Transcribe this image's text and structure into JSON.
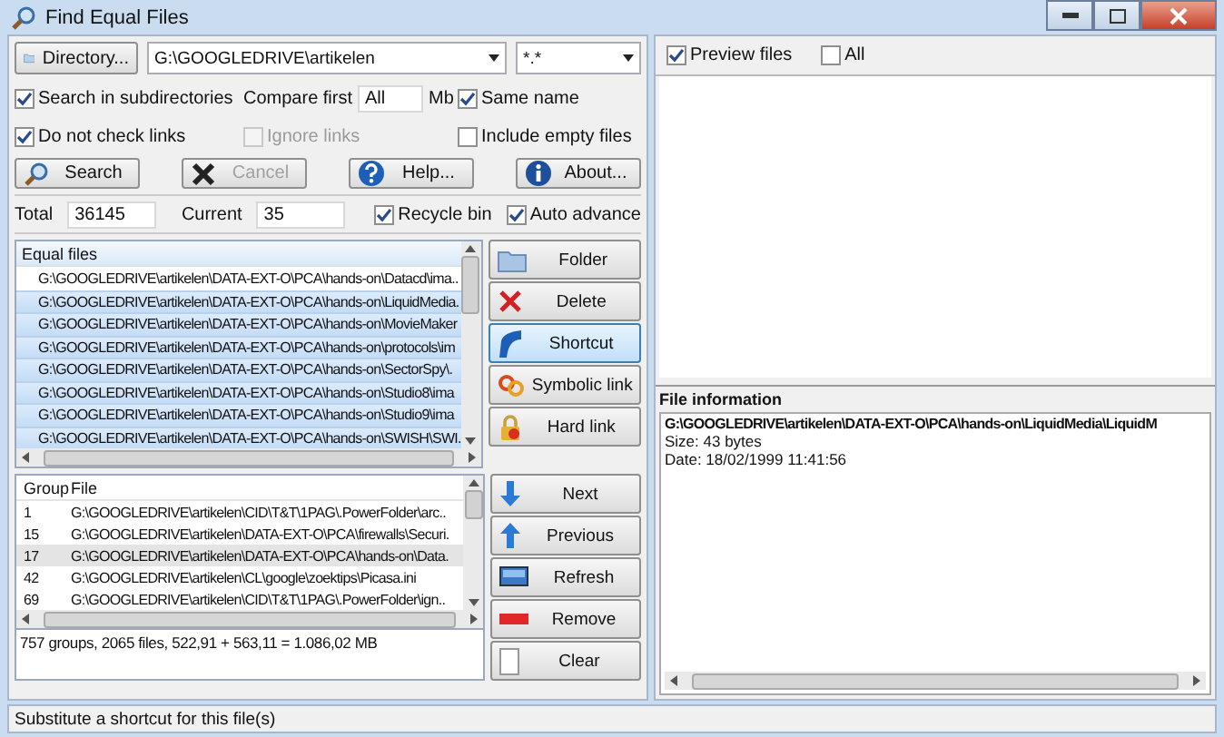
{
  "window": {
    "title": "Find Equal Files"
  },
  "search": {
    "directory_button": "Directory...",
    "path": "G:\\GOOGLEDRIVE\\artikelen",
    "mask": "*.*",
    "options": [
      {
        "label": "Search in subdirectories",
        "checked": true,
        "disabled": false
      },
      {
        "label": "Same name",
        "checked": true,
        "disabled": false
      },
      {
        "label": "Do not check links",
        "checked": true,
        "disabled": false
      },
      {
        "label": "Ignore links",
        "checked": false,
        "disabled": true
      },
      {
        "label": "Include empty files",
        "checked": false,
        "disabled": false
      }
    ],
    "compare_first": {
      "label": "Compare first",
      "value": "All",
      "unit": "Mb"
    }
  },
  "actions": [
    {
      "label": "Search",
      "disabled": false
    },
    {
      "label": "Cancel",
      "disabled": true
    },
    {
      "label": "Help...",
      "disabled": false
    },
    {
      "label": "About...",
      "disabled": false
    }
  ],
  "counters": {
    "total_label": "Total",
    "total": "36145",
    "current_label": "Current",
    "current": "35",
    "options": [
      {
        "label": "Recycle bin",
        "checked": true
      },
      {
        "label": "Auto advance",
        "checked": true
      }
    ]
  },
  "equal_files": {
    "header": "Equal files",
    "rows": [
      {
        "path": "G:\\GOOGLEDRIVE\\artikelen\\DATA-EXT-O\\PCA\\hands-on\\Datacd\\ima..",
        "selected": false
      },
      {
        "path": "G:\\GOOGLEDRIVE\\artikelen\\DATA-EXT-O\\PCA\\hands-on\\LiquidMedia.",
        "selected": true
      },
      {
        "path": "G:\\GOOGLEDRIVE\\artikelen\\DATA-EXT-O\\PCA\\hands-on\\MovieMaker",
        "selected": true
      },
      {
        "path": "G:\\GOOGLEDRIVE\\artikelen\\DATA-EXT-O\\PCA\\hands-on\\protocols\\im",
        "selected": true
      },
      {
        "path": "G:\\GOOGLEDRIVE\\artikelen\\DATA-EXT-O\\PCA\\hands-on\\SectorSpy\\.",
        "selected": true
      },
      {
        "path": "G:\\GOOGLEDRIVE\\artikelen\\DATA-EXT-O\\PCA\\hands-on\\Studio8\\ima",
        "selected": true
      },
      {
        "path": "G:\\GOOGLEDRIVE\\artikelen\\DATA-EXT-O\\PCA\\hands-on\\Studio9\\ima",
        "selected": true
      },
      {
        "path": "G:\\GOOGLEDRIVE\\artikelen\\DATA-EXT-O\\PCA\\hands-on\\SWISH\\SWI.",
        "selected": true
      }
    ]
  },
  "file_buttons": [
    {
      "label": "Folder",
      "selected": false
    },
    {
      "label": "Delete",
      "selected": false
    },
    {
      "label": "Shortcut",
      "selected": true
    },
    {
      "label": "Symbolic link",
      "selected": false
    },
    {
      "label": "Hard link",
      "selected": false
    }
  ],
  "groups": {
    "columns": [
      "Group",
      "File"
    ],
    "rows": [
      {
        "group": "1",
        "file": "G:\\GOOGLEDRIVE\\artikelen\\CID\\T&T\\1PAG\\.PowerFolder\\arc..",
        "selected": false
      },
      {
        "group": "15",
        "file": "G:\\GOOGLEDRIVE\\artikelen\\DATA-EXT-O\\PCA\\firewalls\\Securi.",
        "selected": false
      },
      {
        "group": "17",
        "file": "G:\\GOOGLEDRIVE\\artikelen\\DATA-EXT-O\\PCA\\hands-on\\Data.",
        "selected": true
      },
      {
        "group": "42",
        "file": "G:\\GOOGLEDRIVE\\artikelen\\CL\\google\\zoektips\\Picasa.ini",
        "selected": false
      },
      {
        "group": "69",
        "file": "G:\\GOOGLEDRIVE\\artikelen\\CID\\T&T\\1PAG\\.PowerFolder\\ign..",
        "selected": false
      }
    ]
  },
  "nav_buttons": [
    {
      "label": "Next"
    },
    {
      "label": "Previous"
    },
    {
      "label": "Refresh"
    },
    {
      "label": "Remove"
    },
    {
      "label": "Clear"
    }
  ],
  "summary": "757 groups, 2065 files, 522,91 + 563,11 = 1.086,02 MB",
  "status_bar": "Substitute a shortcut for this file(s)",
  "preview": {
    "options": [
      {
        "label": "Preview files",
        "checked": true
      },
      {
        "label": "All",
        "checked": false
      }
    ]
  },
  "file_info": {
    "title": "File information",
    "path": "G:\\GOOGLEDRIVE\\artikelen\\DATA-EXT-O\\PCA\\hands-on\\LiquidMedia\\LiquidM",
    "size": "Size: 43 bytes",
    "date": "Date: 18/02/1999 11:41:56"
  }
}
